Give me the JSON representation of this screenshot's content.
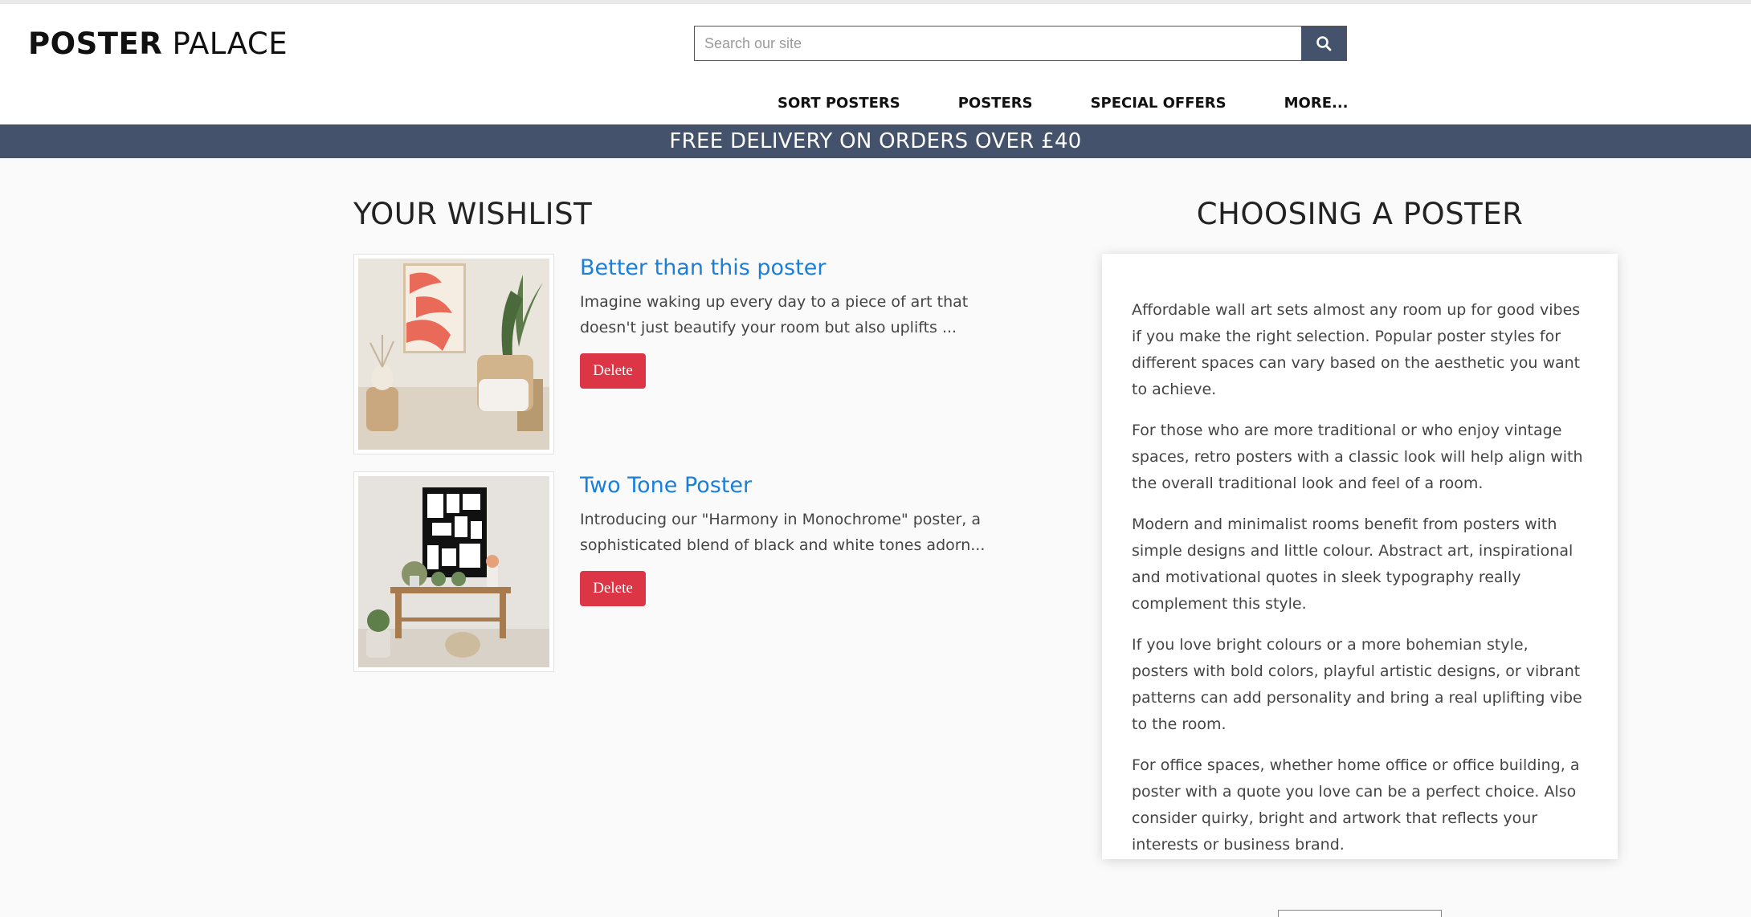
{
  "colors": {
    "brand_navy": "#44526b",
    "link_blue": "#1a7fd9",
    "delete_red": "#dc3545"
  },
  "header": {
    "logo_bold": "POSTER",
    "logo_light": "PALACE",
    "search": {
      "placeholder": "Search our site",
      "value": "",
      "button_icon": "search-icon"
    },
    "nav": [
      "SORT POSTERS",
      "POSTERS",
      "SPECIAL OFFERS",
      "MORE..."
    ]
  },
  "promo": {
    "text": "FREE DELIVERY ON ORDERS OVER £40"
  },
  "wishlist": {
    "title": "YOUR WISHLIST",
    "items": [
      {
        "title": "Better than this poster",
        "description": "Imagine waking up every day to a piece of art that doesn't just beautify your room but also uplifts ...",
        "delete_label": "Delete"
      },
      {
        "title": "Two Tone Poster",
        "description": "Introducing our \"Harmony in Monochrome\" poster, a sophisticated blend of black and white tones adorn...",
        "delete_label": "Delete"
      }
    ]
  },
  "guide": {
    "title": "CHOOSING A POSTER",
    "paragraphs": [
      "Affordable wall art sets almost any room up for good vibes if you make the right selection. Popular poster styles for different spaces can vary based on the aesthetic you want to achieve.",
      "For those who are more traditional or who enjoy vintage spaces, retro posters with a classic look will help align with the overall traditional look and feel of a room.",
      "Modern and minimalist rooms benefit from posters with simple designs and little colour. Abstract art, inspirational and motivational quotes in sleek typography really complement this style.",
      "If you love bright colours or a more bohemian style, posters with bold colors, playful artistic designs, or vibrant patterns can add personality and bring a real uplifting vibe to the room.",
      "For office spaces, whether home office or office building, a poster with a quote you love can be a perfect choice. Also consider quirky, bright and artwork that reflects your interests or business brand."
    ]
  }
}
